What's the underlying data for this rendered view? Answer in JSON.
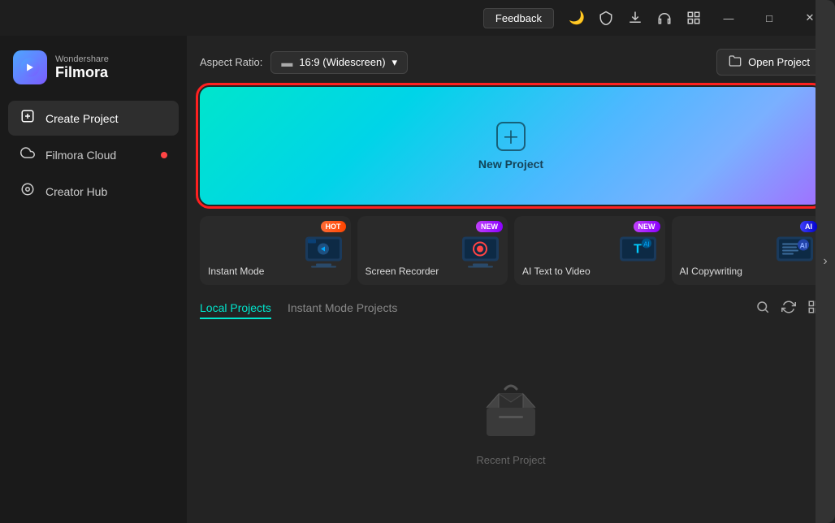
{
  "titlebar": {
    "feedback_label": "Feedback",
    "icons": [
      "🌙",
      "🛡",
      "⬇",
      "🎧",
      "⊞"
    ],
    "minimize": "—",
    "maximize": "□",
    "close": "✕"
  },
  "logo": {
    "brand_top": "Wondershare",
    "brand_name": "Filmora"
  },
  "sidebar": {
    "items": [
      {
        "id": "create-project",
        "label": "Create Project",
        "icon": "⊕",
        "active": true,
        "dot": false
      },
      {
        "id": "filmora-cloud",
        "label": "Filmora Cloud",
        "icon": "☁",
        "active": false,
        "dot": true
      },
      {
        "id": "creator-hub",
        "label": "Creator Hub",
        "icon": "◎",
        "active": false,
        "dot": false
      }
    ]
  },
  "header": {
    "aspect_ratio_label": "Aspect Ratio:",
    "aspect_ratio_value": "16:9 (Widescreen)",
    "open_project_label": "Open Project"
  },
  "new_project": {
    "label": "New Project"
  },
  "feature_cards": [
    {
      "id": "instant-mode",
      "label": "Instant Mode",
      "badge": "HOT",
      "badge_type": "hot"
    },
    {
      "id": "screen-recorder",
      "label": "Screen Recorder",
      "badge": "NEW",
      "badge_type": "new"
    },
    {
      "id": "ai-text-to-video",
      "label": "AI Text to Video",
      "badge": "NEW",
      "badge_type": "new"
    },
    {
      "id": "ai-copywriting",
      "label": "AI Copywriting",
      "badge": "AI",
      "badge_type": "ai"
    }
  ],
  "projects": {
    "tabs": [
      {
        "id": "local",
        "label": "Local Projects",
        "active": true
      },
      {
        "id": "instant",
        "label": "Instant Mode Projects",
        "active": false
      }
    ],
    "empty_label": "Recent Project",
    "actions": [
      "🔍",
      "↺",
      "⊞"
    ]
  }
}
